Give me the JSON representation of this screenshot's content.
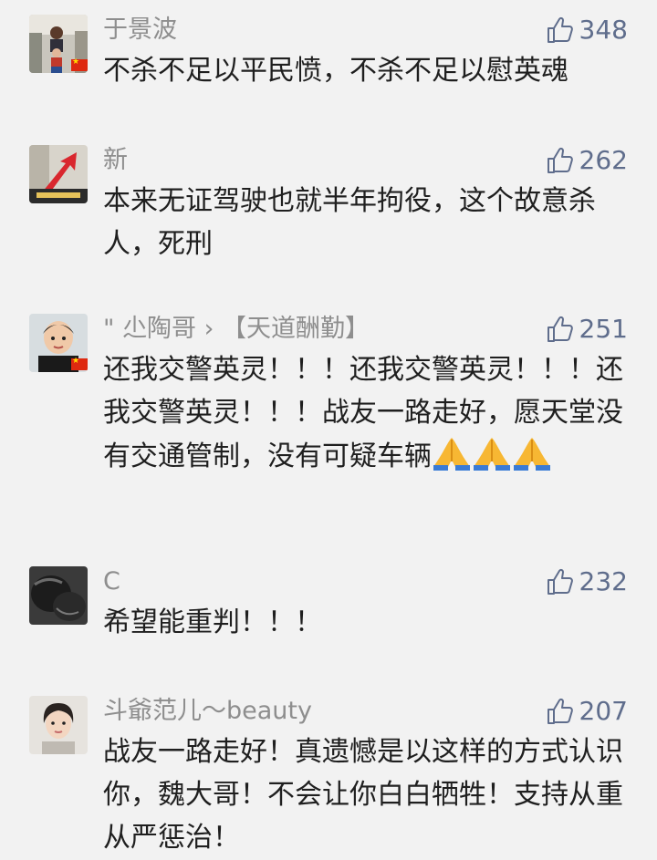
{
  "comments": [
    {
      "name": "于景波",
      "likes": "348",
      "text": "不杀不足以平民愤，不杀不足以慰英魂",
      "flag": true
    },
    {
      "name": "新",
      "likes": "262",
      "text": "本来无证驾驶也就半年拘役，这个故意杀人，死刑",
      "flag": false
    },
    {
      "name": "\" 尐陶哥 › 【天道酬勤】",
      "likes": "251",
      "text": "还我交警英灵！！！还我交警英灵！！！还我交警英灵！！！战友一路走好，愿天堂没有交通管制，没有可疑车辆",
      "emoji": [
        "folded-hands",
        "folded-hands",
        "folded-hands"
      ],
      "flag": true
    },
    {
      "name": "C",
      "likes": "232",
      "text": "希望能重判！！！",
      "flag": false
    },
    {
      "name": "斗爺范儿～beauty",
      "likes": "207",
      "text": "战友一路走好！真遗憾是以这样的方式认识你，魏大哥！不会让你白白牺牲！支持从重从严惩治！",
      "flag": false
    }
  ],
  "colors": {
    "background": "#f2f2f2",
    "name": "#8e8e8e",
    "like": "#5f6d8c",
    "text": "#1f1f1f"
  }
}
